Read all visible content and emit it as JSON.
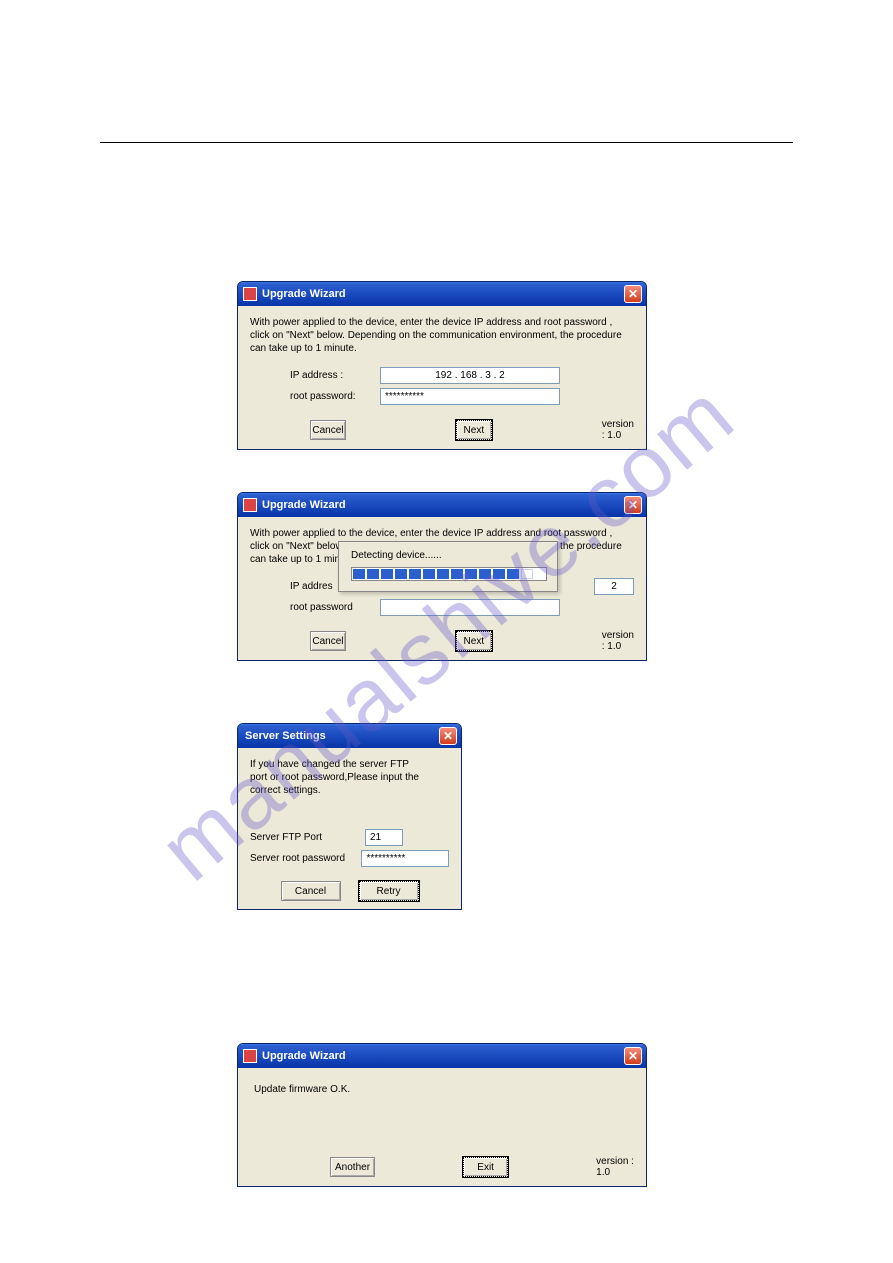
{
  "watermark": "manualshive.com",
  "dialog1": {
    "title": "Upgrade Wizard",
    "instruction": "With power applied to the device, enter the device IP address and root password , click on \"Next\" below. Depending on the communication environment, the procedure can take up to 1 minute.",
    "ip_label": "IP address :",
    "ip_value": "192 . 168 .  3  .  2",
    "pw_label": "root password:",
    "pw_value": "**********",
    "cancel": "Cancel",
    "next": "Next",
    "version": "version : 1.0"
  },
  "dialog2": {
    "title": "Upgrade Wizard",
    "instruction": "With power applied to the device, enter the device IP address and root password , click on \"Next\" below. Depending on the communication environment, the procedure can take up to 1 minute.",
    "ip_label": "IP addres",
    "ip_tail": "2",
    "pw_label": "root password",
    "cancel": "Cancel",
    "next": "Next",
    "version": "version : 1.0",
    "progress_label": "Detecting device......"
  },
  "dialog3": {
    "title": "Server Settings",
    "instruction": "If you have changed the server FTP port or root password,Please input the correct settings.",
    "ftp_label": "Server FTP Port",
    "ftp_value": "21",
    "pw_label": "Server root password",
    "pw_value": "**********",
    "cancel": "Cancel",
    "retry": "Retry"
  },
  "dialog4": {
    "title": "Upgrade Wizard",
    "message": "Update firmware O.K.",
    "another": "Another",
    "exit": "Exit",
    "version": "version : 1.0"
  }
}
